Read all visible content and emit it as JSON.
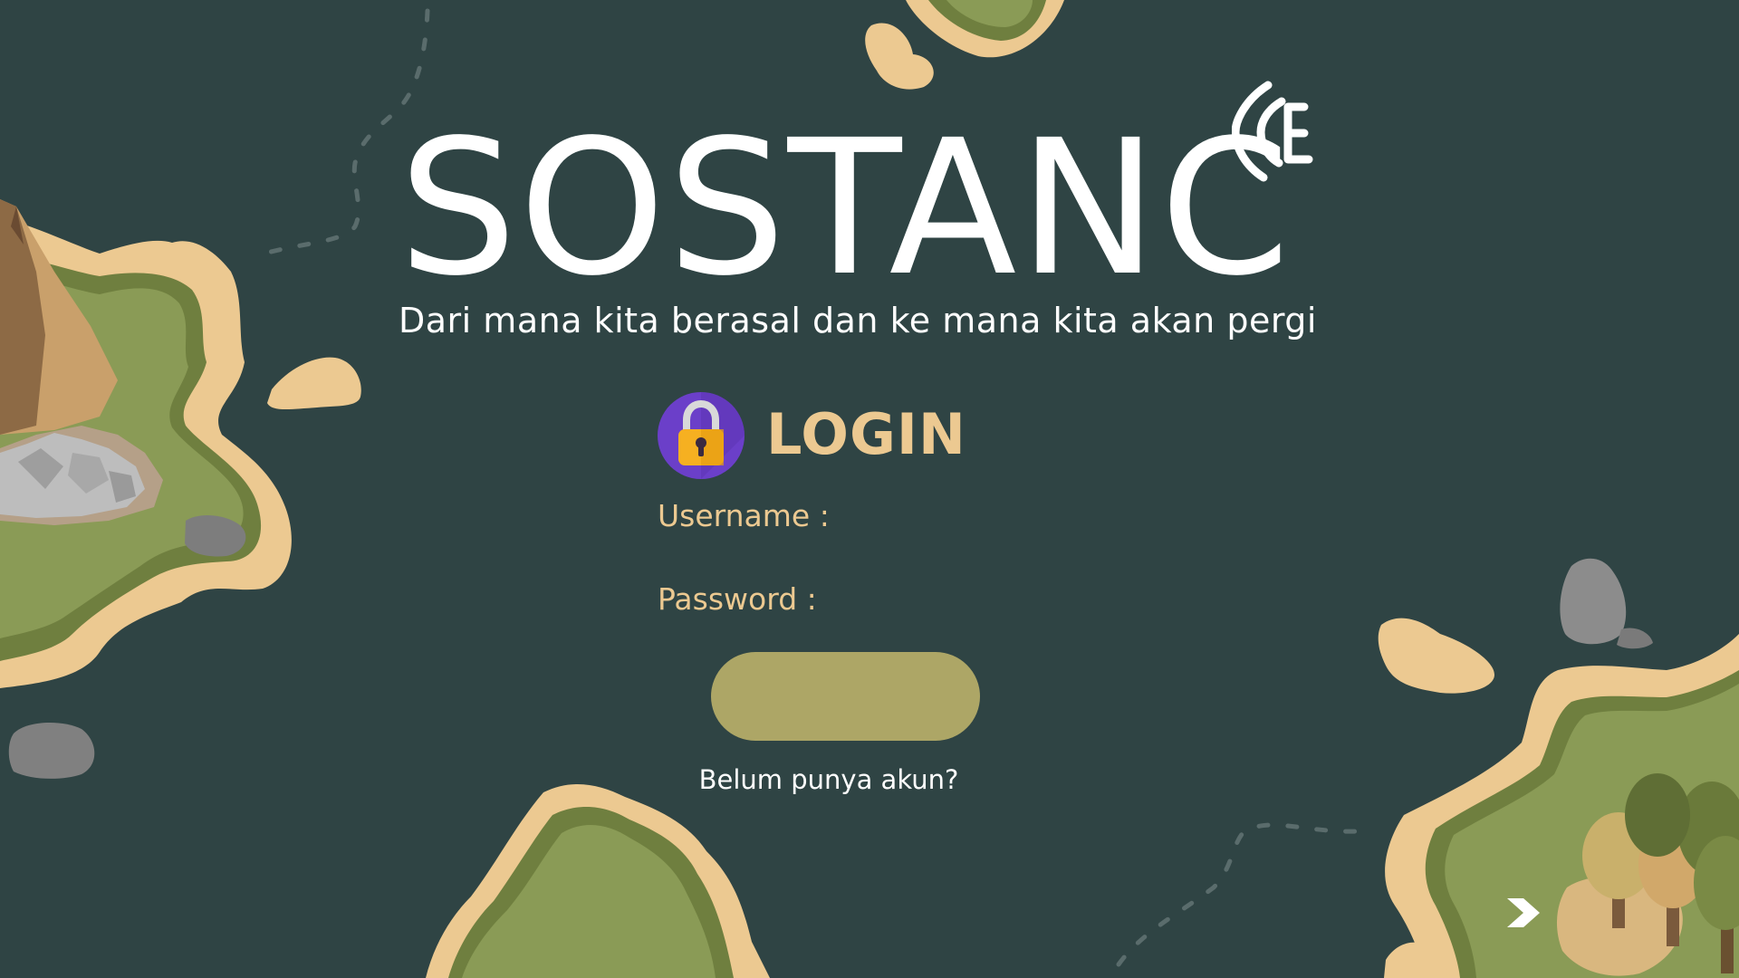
{
  "brand": {
    "title": "SOSTANC",
    "title_mark": "E",
    "tagline": "Dari mana kita berasal dan ke mana kita akan pergi"
  },
  "login": {
    "heading": "LOGIN",
    "lock_icon": "padlock-icon",
    "username_label": "Username :",
    "username_value": "",
    "password_label": "Password  :",
    "password_value": "",
    "submit_label": "",
    "register_link": "Belum punya akun?"
  },
  "navigation": {
    "next_icon": "chevron-right-icon"
  },
  "colors": {
    "background": "#2f4444",
    "accent_text": "#ecc991",
    "button": "#ada666",
    "island_grass": "#8a9b56",
    "island_sand": "#ecc991",
    "lock_circle": "#6b3fc9",
    "lock_body": "#f6b021"
  }
}
